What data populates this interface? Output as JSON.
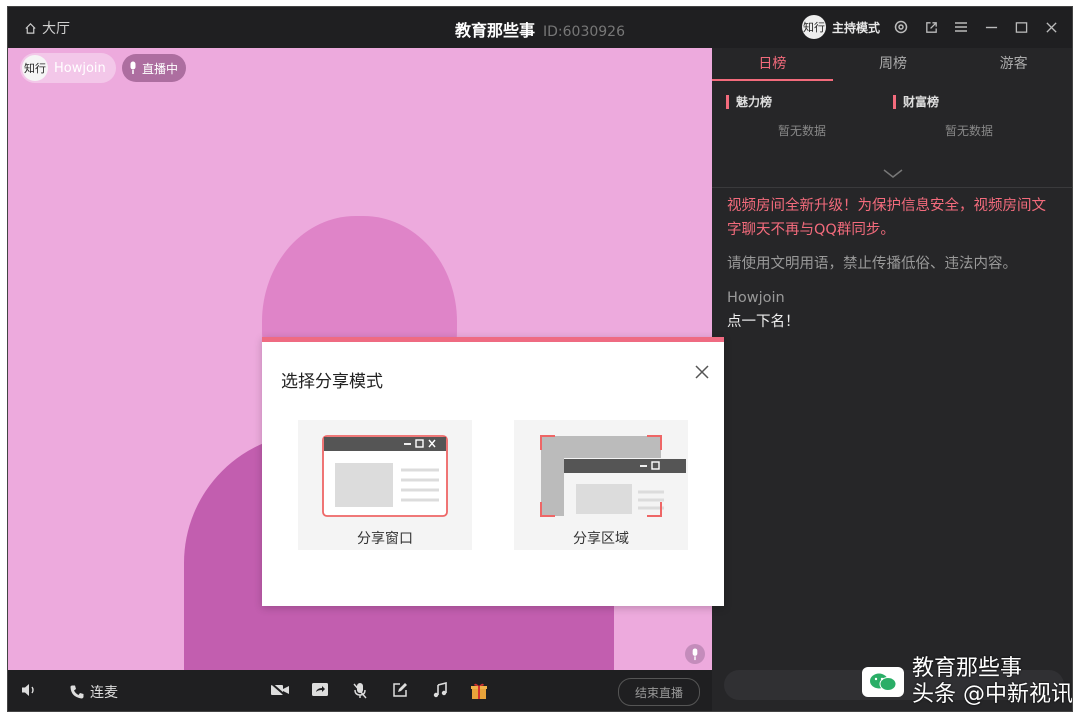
{
  "titlebar": {
    "home_label": "大厅",
    "room_name": "教育那些事",
    "room_id": "ID:6030926",
    "avatar_text": "知行",
    "mode_label": "主持模式"
  },
  "stage": {
    "host_name": "Howjoin",
    "host_avatar_text": "知行",
    "live_label": "直播中"
  },
  "bottombar": {
    "connect_label": "连麦",
    "end_live_label": "结束直播"
  },
  "rank": {
    "tabs": [
      "日榜",
      "周榜",
      "游客"
    ],
    "active_tab_index": 0,
    "charm_title": "魅力榜",
    "wealth_title": "财富榜",
    "empty_text": "暂无数据"
  },
  "chat": {
    "notice": "视频房间全新升级！为保护信息安全，视频房间文字聊天不再与QQ群同步。",
    "rules": "请使用文明用语，禁止传播低俗、违法内容。",
    "messages": [
      {
        "user": "Howjoin",
        "text": "点一下名！"
      }
    ]
  },
  "dialog": {
    "title": "选择分享模式",
    "options": [
      {
        "label": "分享窗口",
        "icon": "share-window-icon"
      },
      {
        "label": "分享区域",
        "icon": "share-region-icon"
      }
    ]
  },
  "watermark": {
    "text": "头条 @中新视讯",
    "overlay_text": "教育那些事"
  },
  "colors": {
    "accent": "#f36b7c",
    "stage_bg": "#edaadd",
    "panel_bg": "#262628"
  }
}
